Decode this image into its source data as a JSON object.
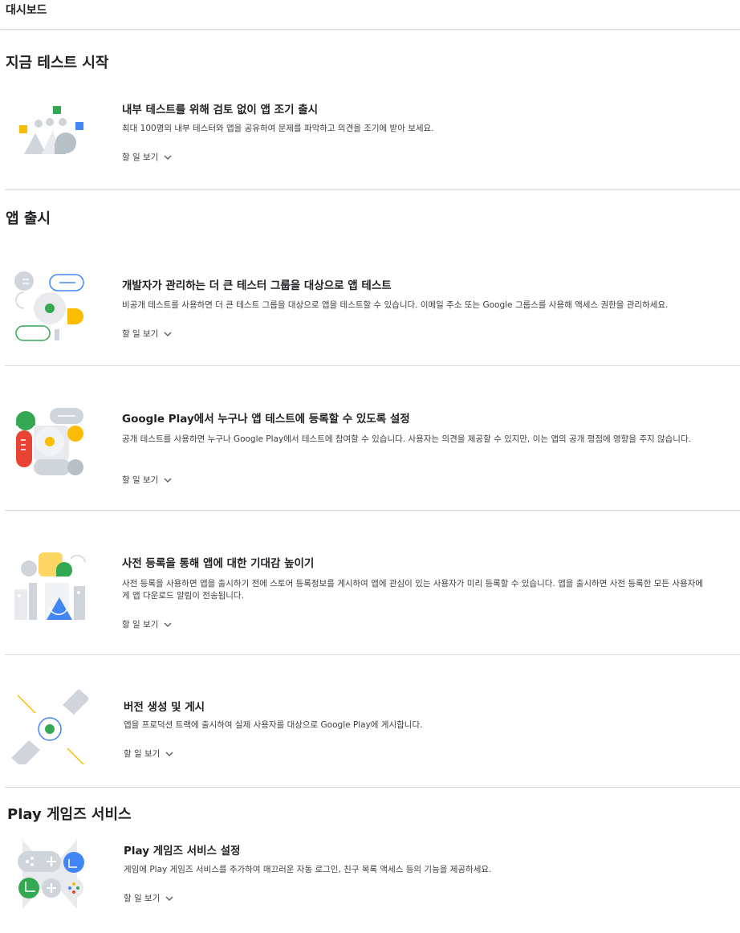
{
  "header": {
    "title": "대시보드"
  },
  "sections": {
    "start_testing": {
      "title": "지금 테스트 시작"
    },
    "release": {
      "title": "앱 출시"
    },
    "games": {
      "title": "Play 게임즈 서비스"
    }
  },
  "cards": [
    {
      "title": "내부 테스트를 위해 검토 없이 앱 조기 출시",
      "desc": "최대 100명의 내부 테스터와 앱을 공유하여 문제를 파악하고 의견을 조기에 받아 보세요.",
      "todo": "할 일 보기"
    },
    {
      "title": "개발자가 관리하는 더 큰 테스터 그룹을 대상으로 앱 테스트",
      "desc": "비공개 테스트를 사용하면 더 큰 테스트 그룹을 대상으로 앱을 테스트할 수 있습니다. 이메일 주소 또는 Google 그룹스를 사용해 액세스 권한을 관리하세요.",
      "todo": "할 일 보기"
    },
    {
      "title": "Google Play에서 누구나 앱 테스트에 등록할 수 있도록 설정",
      "desc": "공개 테스트를 사용하면 누구나 Google Play에서 테스트에 참여할 수 있습니다. 사용자는 의견을 제공할 수 있지만, 이는 앱의 공개 평점에 영향을 주지 않습니다.",
      "todo": "할 일 보기"
    },
    {
      "title": "사전 등록을 통해 앱에 대한 기대감 높이기",
      "desc": "사전 등록을 사용하면 앱을 출시하기 전에 스토어 등록정보를 게시하여 앱에 관심이 있는 사용자가 미리 등록할 수 있습니다. 앱을 출시하면 사전 등록한 모든 사용자에게 앱 다운로드 알림이 전송됩니다.",
      "todo": "할 일 보기"
    },
    {
      "title": "버전 생성 및 게시",
      "desc": "앱을 프로덕션 트랙에 출시하여 실제 사용자를 대상으로 Google Play에 게시합니다.",
      "todo": "할 일 보기"
    },
    {
      "title": "Play 게임즈 서비스 설정",
      "desc": "게임에 Play 게임즈 서비스를 추가하여 매끄러운 자동 로그인, 친구 목록 액세스 등의 기능을 제공하세요.",
      "todo": "할 일 보기"
    }
  ],
  "colors": {
    "green": "#34a853",
    "yellow": "#fbbc04",
    "blue": "#4285f4",
    "red": "#ea4335",
    "gray": "#cfd5da"
  }
}
